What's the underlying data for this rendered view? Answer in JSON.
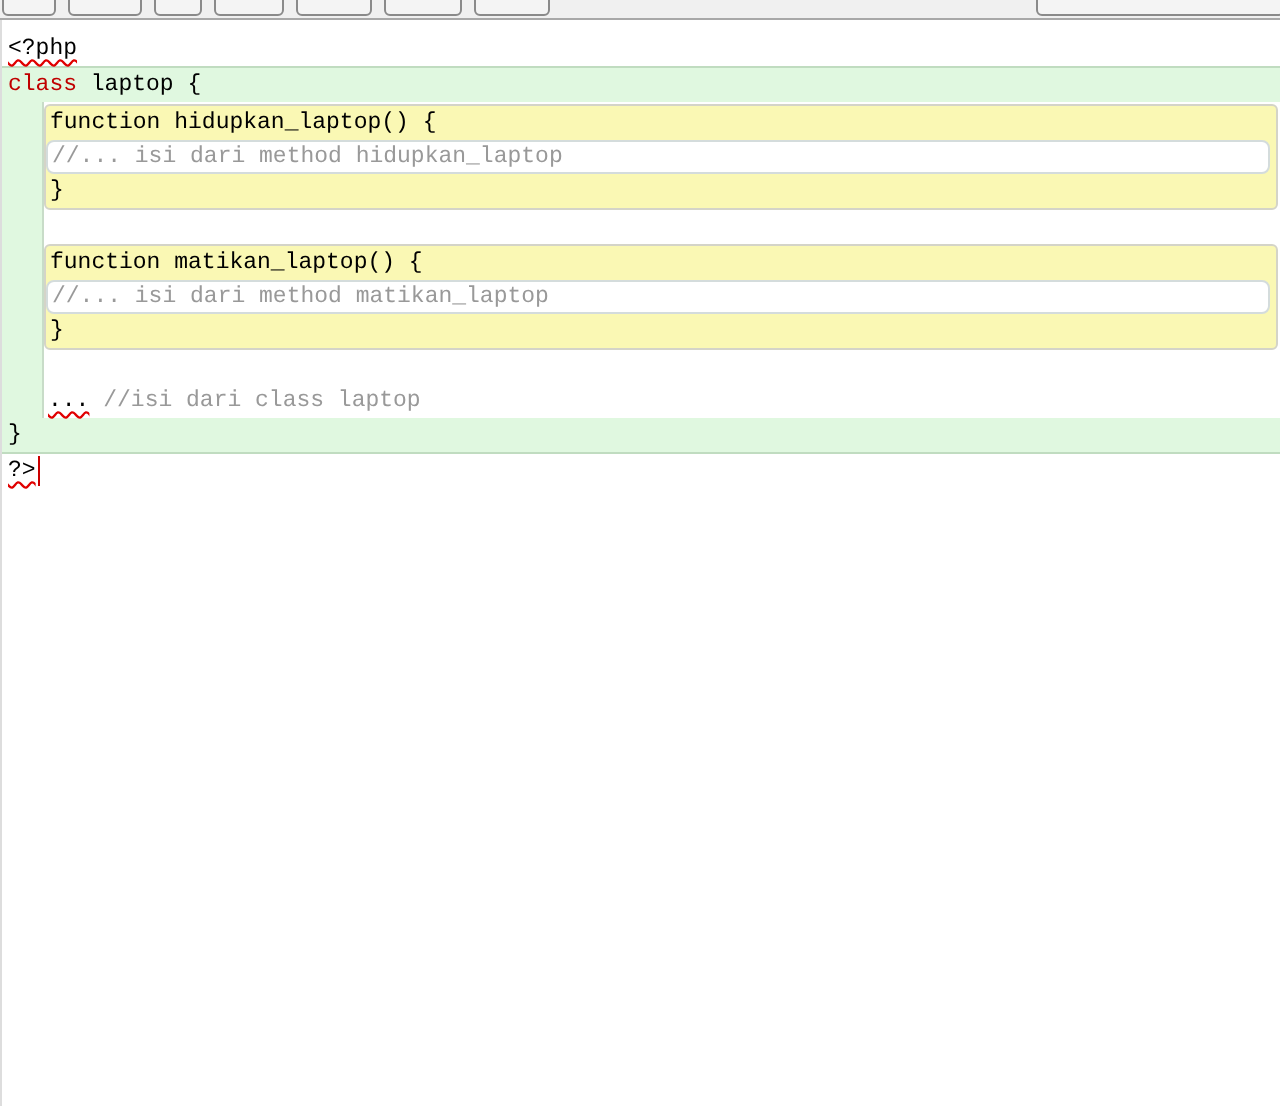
{
  "code": {
    "open_tag": {
      "text": "<?php",
      "misspelled": true
    },
    "class_block": {
      "keyword": "class",
      "header": "laptop {",
      "methods": [
        {
          "header": "function hidupkan_laptop() {",
          "body": "//... isi dari method hidupkan_laptop",
          "closing": "}"
        },
        {
          "header": "function matikan_laptop() {",
          "body": "//... isi dari method matikan_laptop",
          "closing": "}"
        }
      ],
      "tail": [
        {
          "kind": "plain",
          "text": "...",
          "misspelled": true
        },
        {
          "kind": "comment",
          "text": "//isi dari class laptop",
          "misspelled": false
        }
      ],
      "closing": "}"
    },
    "close_tag": {
      "text": "?>",
      "misspelled": true
    }
  }
}
